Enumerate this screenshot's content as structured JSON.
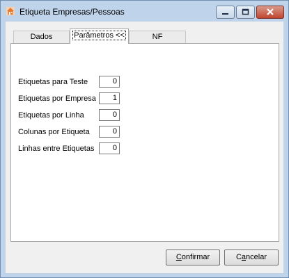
{
  "window": {
    "title": "Etiqueta Empresas/Pessoas",
    "icon": "orange-house-icon"
  },
  "tabs": [
    {
      "label": "Dados",
      "active": false
    },
    {
      "label": "Parâmetros <<",
      "active": true
    },
    {
      "label": "NF",
      "active": false
    }
  ],
  "fields": [
    {
      "label": "Etiquetas para Teste",
      "value": "0"
    },
    {
      "label": "Etiquetas por Empresa",
      "value": "1"
    },
    {
      "label": "Etiquetas por Linha",
      "value": "0"
    },
    {
      "label": "Colunas por Etiqueta",
      "value": "0"
    },
    {
      "label": "Linhas entre Etiquetas",
      "value": "0"
    }
  ],
  "buttons": {
    "confirm_first": "C",
    "confirm_rest": "onfirmar",
    "cancel_first": "C",
    "cancel_mid": "a",
    "cancel_rest": "ncelar"
  },
  "colors": {
    "titlebar": "#bfd3ea",
    "close_button": "#c0462f",
    "window_bg": "#f0f0f0"
  }
}
